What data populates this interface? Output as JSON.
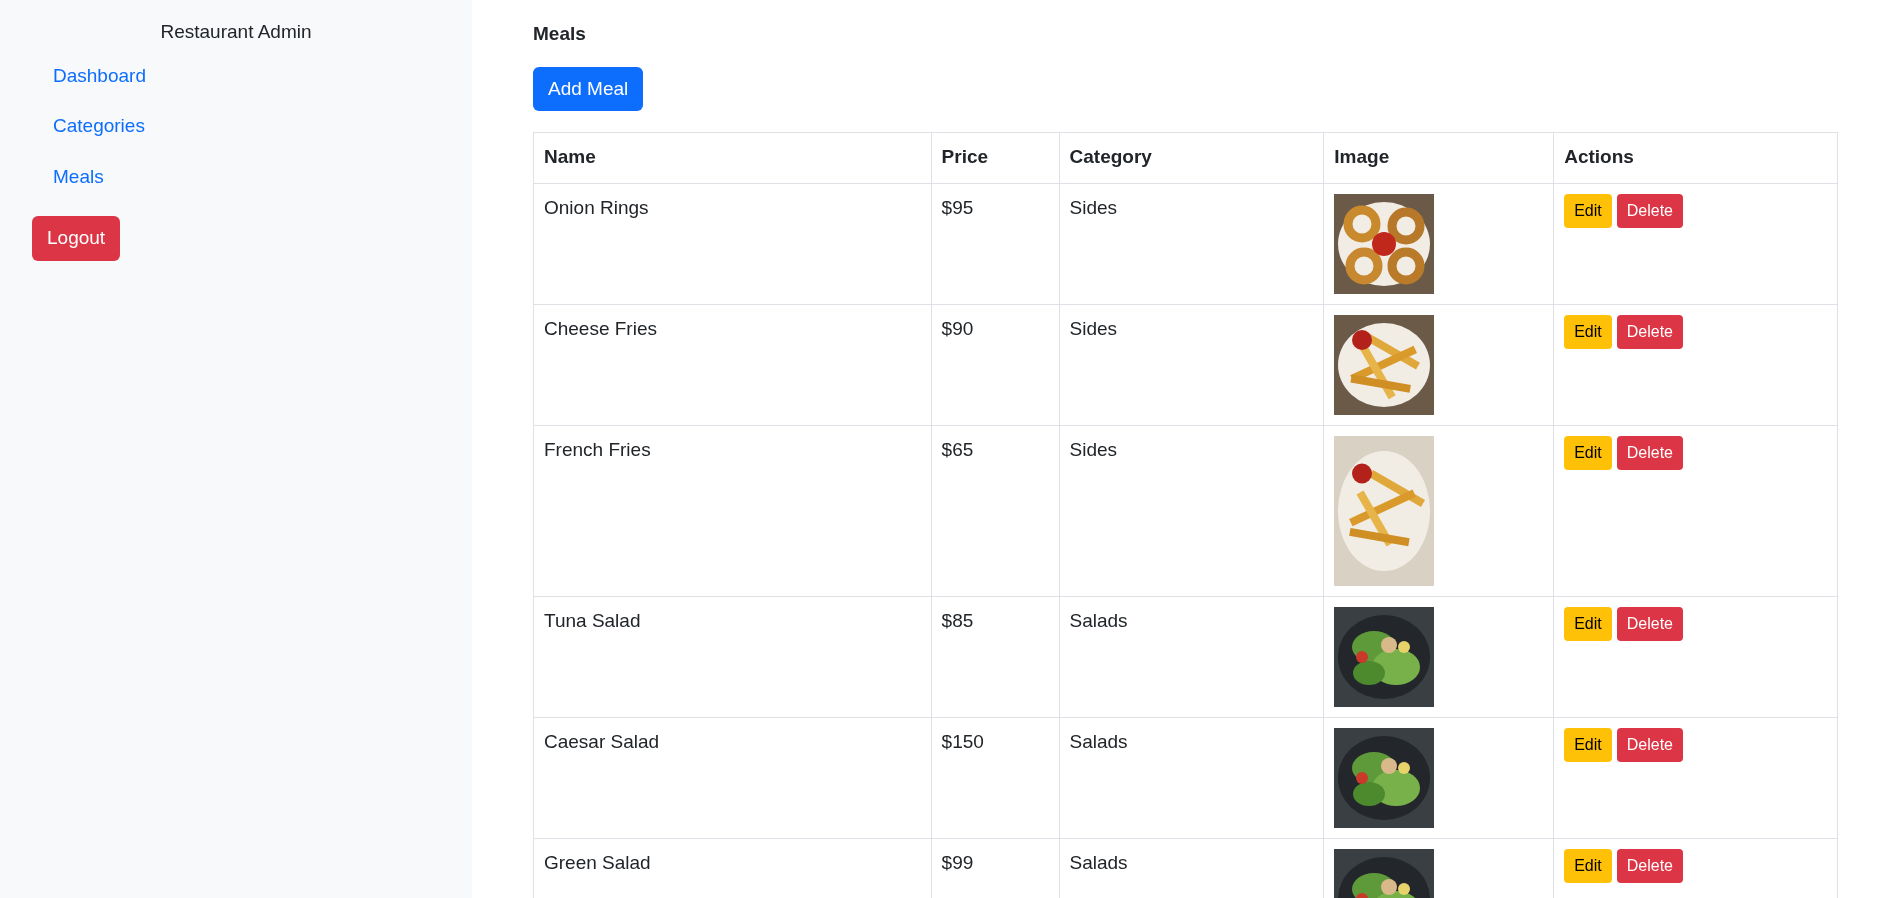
{
  "sidebar": {
    "title": "Restaurant Admin",
    "links": [
      "Dashboard",
      "Categories",
      "Meals"
    ],
    "logout": "Logout"
  },
  "main": {
    "heading": "Meals",
    "add_button": "Add Meal",
    "table": {
      "columns": [
        "Name",
        "Price",
        "Category",
        "Image",
        "Actions"
      ],
      "rows": [
        {
          "name": "Onion Rings",
          "price": "$95",
          "category": "Sides",
          "edit": "Edit",
          "delete": "Delete"
        },
        {
          "name": "Cheese Fries",
          "price": "$90",
          "category": "Sides",
          "edit": "Edit",
          "delete": "Delete"
        },
        {
          "name": "French Fries",
          "price": "$65",
          "category": "Sides",
          "edit": "Edit",
          "delete": "Delete"
        },
        {
          "name": "Tuna Salad",
          "price": "$85",
          "category": "Salads",
          "edit": "Edit",
          "delete": "Delete"
        },
        {
          "name": "Caesar Salad",
          "price": "$150",
          "category": "Salads",
          "edit": "Edit",
          "delete": "Delete"
        },
        {
          "name": "Green Salad",
          "price": "$99",
          "category": "Salads",
          "edit": "Edit",
          "delete": "Delete"
        }
      ]
    }
  }
}
